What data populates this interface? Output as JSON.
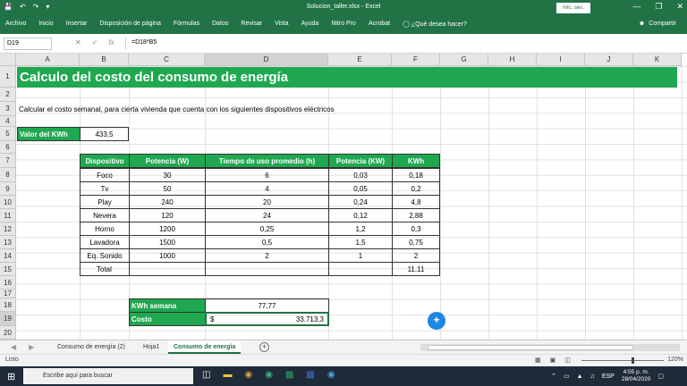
{
  "titlebar": {
    "doc_title": "Solucion_taller.xlsx - Excel",
    "signin": "Inic. ses.",
    "minimize": "—",
    "restore": "❐",
    "close": "✕"
  },
  "ribbon": {
    "tabs": [
      "Archivo",
      "Inicio",
      "Insertar",
      "Disposición de página",
      "Fórmulas",
      "Datos",
      "Revisar",
      "Vista",
      "Ayuda",
      "Nitro Pro",
      "Acrobat",
      "¿Qué desea hacer?"
    ],
    "share": "Compartir"
  },
  "formula_bar": {
    "name_box": "D19",
    "formula": "=D18*B5"
  },
  "columns": [
    "A",
    "B",
    "C",
    "D",
    "E",
    "F",
    "G",
    "H",
    "I",
    "J",
    "K"
  ],
  "rows": [
    "1",
    "2",
    "3",
    "4",
    "5",
    "6",
    "7",
    "8",
    "9",
    "10",
    "11",
    "12",
    "13",
    "14",
    "15",
    "16",
    "17",
    "18",
    "19",
    "20"
  ],
  "sheet": {
    "title": "Calculo del costo del consumo de energía",
    "subtitle": "Calcular el costo semanal, para cierta vivienda que cuenta con los siguientes dispositivos eléctricos",
    "kwh_label": "Valor del KWh",
    "kwh_value": "433,5",
    "table_headers": [
      "Dispositivo",
      "Potencia (W)",
      "Tiempo de uso promedio (h)",
      "Potencia (KW)",
      "KWh"
    ],
    "table_rows": [
      [
        "Foco",
        "30",
        "6",
        "0,03",
        "0,18"
      ],
      [
        "Tv",
        "50",
        "4",
        "0,05",
        "0,2"
      ],
      [
        "Play",
        "240",
        "20",
        "0,24",
        "4,8"
      ],
      [
        "Nevera",
        "120",
        "24",
        "0,12",
        "2,88"
      ],
      [
        "Horno",
        "1200",
        "0,25",
        "1,2",
        "0,3"
      ],
      [
        "Lavadora",
        "1500",
        "0,5",
        "1,5",
        "0,75"
      ],
      [
        "Eq. Sonido",
        "1000",
        "2",
        "1",
        "2"
      ]
    ],
    "total_label": "Total",
    "total_value": "11,11",
    "kwh_semana_label": "KWh semana",
    "kwh_semana_value": "77,77",
    "costo_label": "Costo",
    "costo_currency": "$",
    "costo_value": "33.713,3"
  },
  "sheet_tabs": [
    "Consumo de energía (2)",
    "Hoja1",
    "Consumo de energía"
  ],
  "status": {
    "ready": "Listo",
    "zoom": "120%"
  },
  "taskbar": {
    "search_placeholder": "Escribe aquí para buscar",
    "lang": "ESP",
    "time": "4:55 p. m.",
    "date": "28/04/2020"
  }
}
